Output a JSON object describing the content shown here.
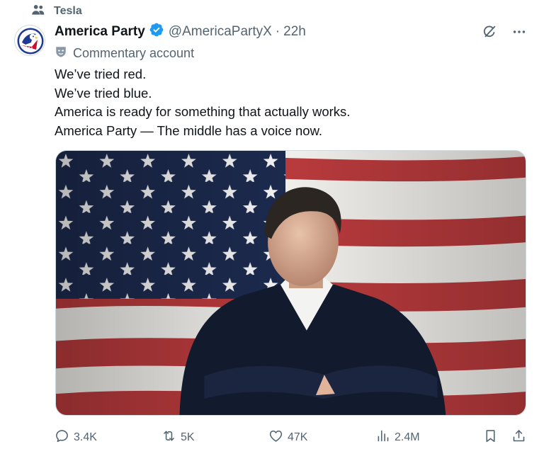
{
  "context": {
    "label": "Tesla",
    "icon": "people-icon"
  },
  "author": {
    "name": "America Party",
    "handle": "@AmericaPartyX",
    "separator": "·",
    "time": "22h",
    "badge": "Commentary account",
    "verified_color": "#1d9bf0"
  },
  "tweet": {
    "lines": [
      "We’ve tried red.",
      "We’ve tried blue.",
      "America is ready for something that actually works.",
      "America Party — The middle has a voice now."
    ]
  },
  "actions": {
    "replies": "3.4K",
    "reposts": "5K",
    "likes": "47K",
    "views": "2.4M"
  },
  "colors": {
    "text": "#0f1419",
    "secondary": "#536471",
    "accent": "#1d9bf0"
  }
}
